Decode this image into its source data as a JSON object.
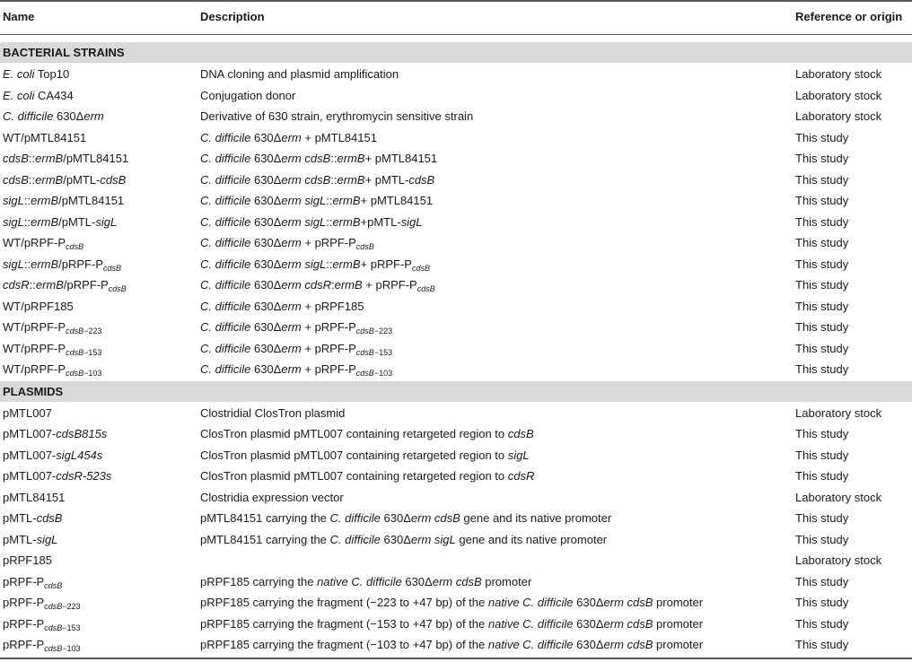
{
  "headers": {
    "name": "Name",
    "description": "Description",
    "reference": "Reference or origin"
  },
  "sections": [
    {
      "title": "BACTERIAL STRAINS",
      "rows": [
        {
          "name": "<i>E. coli</i> Top10",
          "description": "DNA cloning and plasmid amplification",
          "reference": "Laboratory stock"
        },
        {
          "name": "<i>E. coli</i> CA434",
          "description": "Conjugation donor",
          "reference": "Laboratory stock"
        },
        {
          "name": "<i>C. difficile</i> 630Δ<i>erm</i>",
          "description": "Derivative of 630 strain, erythromycin sensitive strain",
          "reference": "Laboratory stock"
        },
        {
          "name": "WT/pMTL84151",
          "description": "<i>C. difficile</i> 630Δ<i>erm</i> + pMTL84151",
          "reference": "This study"
        },
        {
          "name": "<i>cdsB</i>::<i>ermB</i>/pMTL84151",
          "description": "<i>C. difficile</i> 630Δ<i>erm cdsB</i>::<i>ermB</i>+ pMTL84151",
          "reference": "This study"
        },
        {
          "name": "<i>cdsB</i>::<i>ermB</i>/pMTL-<i>cdsB</i>",
          "description": "<i>C. difficile</i> 630Δ<i>erm cdsB</i>::<i>ermB</i>+ pMTL-<i>cdsB</i>",
          "reference": "This study"
        },
        {
          "name": "<i>sigL</i>::<i>ermB</i>/pMTL84151",
          "description": "<i>C. difficile</i> 630Δ<i>erm sigL</i>::<i>ermB</i>+ pMTL84151",
          "reference": "This study"
        },
        {
          "name": "<i>sigL</i>::<i>ermB</i>/pMTL-<i>sigL</i>",
          "description": "<i>C. difficile</i> 630Δ<i>erm sigL</i>::<i>ermB</i>+pMTL-<i>sigL</i>",
          "reference": "This study"
        },
        {
          "name": "WT/pRPF-P<sub><i>cdsB</i></sub>",
          "description": "<i>C. difficile</i> 630Δ<i>erm</i> + pRPF-P<sub><i>cdsB</i></sub>",
          "reference": "This study"
        },
        {
          "name": "<i>sigL</i>::<i>ermB</i>/pRPF-P<sub><i>cdsB</i></sub>",
          "description": "<i>C. difficile</i> 630Δ<i>erm sigL</i>::<i>ermB</i>+ pRPF-P<sub><i>cdsB</i></sub>",
          "reference": "This study"
        },
        {
          "name": "<i>cdsR</i>::<i>ermB</i>/pRPF-P<sub><i>cdsB</i></sub>",
          "description": "<i>C. difficile</i> 630Δ<i>erm cdsR</i>:<i>ermB</i> + pRPF-P<sub><i>cdsB</i></sub>",
          "reference": "This study"
        },
        {
          "name": "WT/pRPF185",
          "description": "<i>C. difficile</i> 630Δ<i>erm</i> + pRPF185",
          "reference": "This study"
        },
        {
          "name": "WT/pRPF-P<sub><i>cdsB</i>−223</sub>",
          "description": "<i>C. difficile</i> 630Δ<i>erm</i> + pRPF-P<sub><i>cdsB</i>−223</sub>",
          "reference": "This study"
        },
        {
          "name": "WT/pRPF-P<sub><i>cdsB</i>−153</sub>",
          "description": "<i>C. difficile</i> 630Δ<i>erm</i> + pRPF-P<sub><i>cdsB</i>−153</sub>",
          "reference": "This study"
        },
        {
          "name": "WT/pRPF-P<sub><i>cdsB</i>−103</sub>",
          "description": "<i>C. difficile</i> 630Δ<i>erm</i> + pRPF-P<sub><i>cdsB</i>−103</sub>",
          "reference": "This study"
        }
      ]
    },
    {
      "title": "PLASMIDS",
      "rows": [
        {
          "name": "pMTL007",
          "description": "Clostridial ClosTron plasmid",
          "reference": "Laboratory stock"
        },
        {
          "name": "pMTL007-<i>cdsB815s</i>",
          "description": "ClosTron plasmid pMTL007 containing retargeted region to <i>cdsB</i>",
          "reference": "This study"
        },
        {
          "name": "pMTL007-<i>sigL454s</i>",
          "description": "ClosTron plasmid pMTL007 containing retargeted region to <i>sigL</i>",
          "reference": "This study"
        },
        {
          "name": "pMTL007-<i>cdsR-523s</i>",
          "description": "ClosTron plasmid pMTL007 containing retargeted region to <i>cdsR</i>",
          "reference": "This study"
        },
        {
          "name": "pMTL84151",
          "description": "Clostridia expression vector",
          "reference": "Laboratory stock"
        },
        {
          "name": "pMTL-<i>cdsB</i>",
          "description": "pMTL84151 carrying the <i>C. difficile</i> 630Δ<i>erm cdsB</i> gene and its native promoter",
          "reference": "This study"
        },
        {
          "name": "pMTL-<i>sigL</i>",
          "description": "pMTL84151 carrying the <i>C. difficile</i> 630Δ<i>erm sigL</i> gene and its native promoter",
          "reference": "This study"
        },
        {
          "name": "pRPF185",
          "description": "",
          "reference": "Laboratory stock"
        },
        {
          "name": "pRPF-P<sub><i>cdsB</i></sub>",
          "description": "pRPF185 carrying the <i>native C. difficile</i> 630Δ<i>erm cdsB</i> promoter",
          "reference": "This study"
        },
        {
          "name": "pRPF-P<sub><i>cdsB</i>−223</sub>",
          "description": "pRPF185 carrying the fragment (−223 to +47 bp) of the <i>native C. difficile</i> 630Δ<i>erm cdsB</i> promoter",
          "reference": "This study"
        },
        {
          "name": "pRPF-P<sub><i>cdsB</i>−153</sub>",
          "description": "pRPF185 carrying the fragment (−153 to +47 bp) of the <i>native C. difficile</i> 630Δ<i>erm cdsB</i> promoter",
          "reference": "This study"
        },
        {
          "name": "pRPF-P<sub><i>cdsB</i>−103</sub>",
          "description": "pRPF185 carrying the fragment (−103 to +47 bp) of the <i>native C. difficile</i> 630Δ<i>erm cdsB</i> promoter",
          "reference": "This study"
        }
      ]
    }
  ]
}
